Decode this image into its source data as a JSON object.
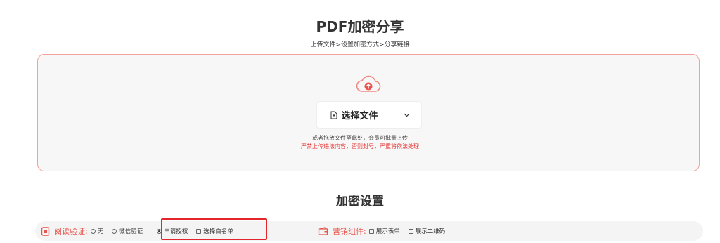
{
  "header": {
    "title": "PDF加密分享",
    "steps": "上传文件>设置加密方式>分享链接"
  },
  "upload": {
    "button_label": "选择文件",
    "hint": "或者拖放文件至此处，会员可批量上传",
    "warning": "严禁上传违法内容，否则封号，严重将依法处理"
  },
  "settings": {
    "title": "加密设置",
    "read_verify": {
      "label": "阅读验证:",
      "options": [
        "无",
        "微信验证",
        "申请授权",
        "选择白名单"
      ],
      "selected": "申请授权"
    },
    "marketing": {
      "label": "营销组件:",
      "options": [
        "展示表单",
        "展示二维码"
      ]
    }
  },
  "colors": {
    "accent": "#e8534a",
    "highlight": "#e3262b",
    "warning_text": "#e52d2d"
  }
}
